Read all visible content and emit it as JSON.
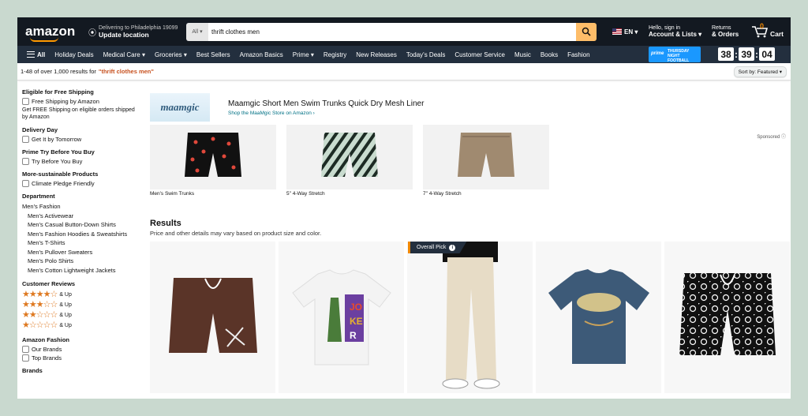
{
  "header": {
    "logo": "amazon",
    "deliver_line1": "Delivering to Philadelphia 19099",
    "deliver_line2": "Update location",
    "search_category": "All",
    "search_value": "thrift clothes men",
    "language": "EN",
    "account_line1": "Hello, sign in",
    "account_line2": "Account & Lists",
    "returns_line1": "Returns",
    "returns_line2": "& Orders",
    "cart_count": "0",
    "cart_label": "Cart"
  },
  "nav": {
    "all_label": "All",
    "items": [
      "Holiday Deals",
      "Medical Care",
      "Groceries",
      "Best Sellers",
      "Amazon Basics",
      "Prime",
      "Registry",
      "New Releases",
      "Today's Deals",
      "Customer Service",
      "Music",
      "Books",
      "Fashion"
    ],
    "promo_prime": "prime",
    "promo_line1": "THURSDAY",
    "promo_line2": "NIGHT",
    "promo_line3": "FOOTBALL",
    "timer": [
      "38",
      "39",
      "04"
    ]
  },
  "results_bar": {
    "count_text": "1-48 of over 1,000 results for",
    "query": "\"thrift clothes men\"",
    "sort_label": "Sort by:",
    "sort_value": "Featured"
  },
  "sidebar": {
    "free_shipping_title": "Eligible for Free Shipping",
    "free_shipping_option": "Free Shipping by Amazon",
    "free_shipping_note": "Get FREE Shipping on eligible orders shipped by Amazon",
    "delivery_title": "Delivery Day",
    "delivery_option": "Get It by Tomorrow",
    "prime_try_title": "Prime Try Before You Buy",
    "prime_try_option": "Try Before You Buy",
    "sustain_title": "More-sustainable Products",
    "sustain_option": "Climate Pledge Friendly",
    "dept_title": "Department",
    "dept_parent": "Men's Fashion",
    "dept_items": [
      "Men's Activewear",
      "Men's Casual Button-Down Shirts",
      "Men's Fashion Hoodies & Sweatshirts",
      "Men's T-Shirts",
      "Men's Pullover Sweaters",
      "Men's Polo Shirts",
      "Men's Cotton Lightweight Jackets"
    ],
    "reviews_title": "Customer Reviews",
    "reviews": [
      {
        "stars": "★★★★☆",
        "label": "& Up"
      },
      {
        "stars": "★★★☆☆",
        "label": "& Up"
      },
      {
        "stars": "★★☆☆☆",
        "label": "& Up"
      },
      {
        "stars": "★☆☆☆☆",
        "label": "& Up"
      }
    ],
    "amz_fashion_title": "Amazon Fashion",
    "amz_fashion_options": [
      "Our Brands",
      "Top Brands"
    ],
    "brands_title": "Brands"
  },
  "sponsored": {
    "brand_logo": "maamgic",
    "title": "Maamgic Short Men Swim Trunks Quick Dry Mesh Liner",
    "link": "Shop the MaaMgic Store on Amazon ›",
    "items": [
      "Men's Swim Trunks",
      "5\" 4-Way Stretch",
      "7\" 4-Way Stretch"
    ],
    "tag": "Sponsored"
  },
  "results": {
    "title": "Results",
    "subtitle": "Price and other details may vary based on product size and color.",
    "badge": "Overall Pick",
    "badge_icon": "info-icon"
  },
  "colors": {
    "header_bg": "#131921",
    "nav_bg": "#232f3e",
    "accent": "#febd69",
    "query_color": "#c7511f",
    "link": "#007185",
    "star": "#de7921"
  }
}
